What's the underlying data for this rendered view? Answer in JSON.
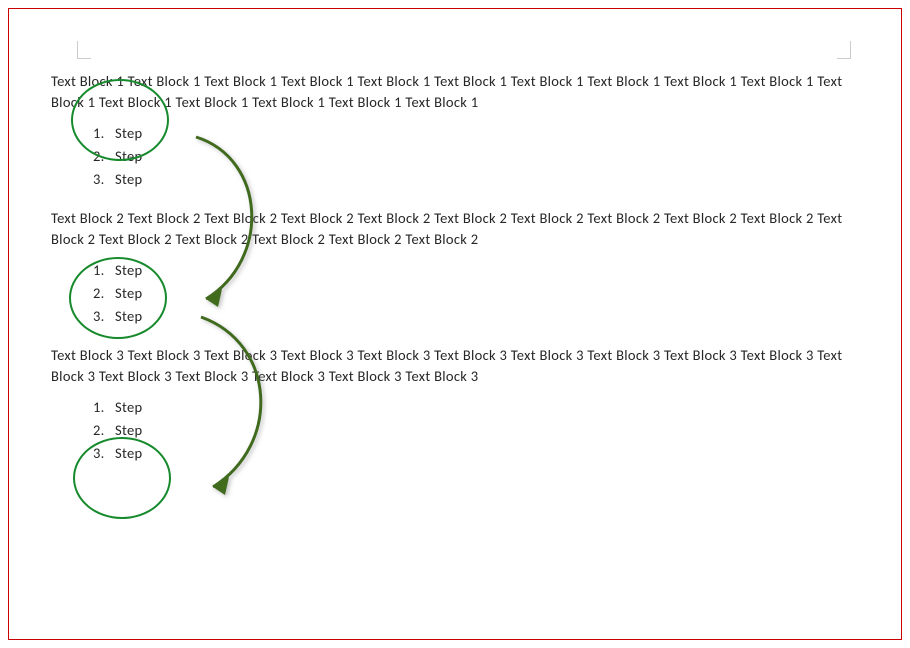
{
  "blocks": [
    {
      "paragraph": "Text Block 1 Text Block 1 Text Block 1 Text Block 1 Text Block 1 Text Block 1 Text Block 1 Text Block 1 Text Block 1 Text Block 1 Text Block 1 Text Block 1 Text Block 1 Text Block 1 Text Block 1 Text Block 1",
      "steps": [
        "Step",
        "Step",
        "Step"
      ]
    },
    {
      "paragraph": "Text Block 2 Text Block 2 Text Block 2 Text Block 2 Text Block 2 Text Block 2 Text Block 2 Text Block 2 Text Block 2 Text Block 2 Text Block 2 Text Block 2 Text Block 2 Text Block 2 Text Block 2 Text Block 2",
      "steps": [
        "Step",
        "Step",
        "Step"
      ]
    },
    {
      "paragraph": "Text Block 3 Text Block 3 Text Block 3 Text Block 3 Text Block 3 Text Block 3 Text Block 3 Text Block 3 Text Block 3 Text Block 3 Text Block 3 Text Block 3 Text Block 3 Text Block 3 Text Block 3 Text Block 3",
      "steps": [
        "Step",
        "Step",
        "Step"
      ]
    }
  ],
  "colors": {
    "frame": "#c00",
    "shape": "#168a2c",
    "arrow": "#3f6b1f"
  }
}
